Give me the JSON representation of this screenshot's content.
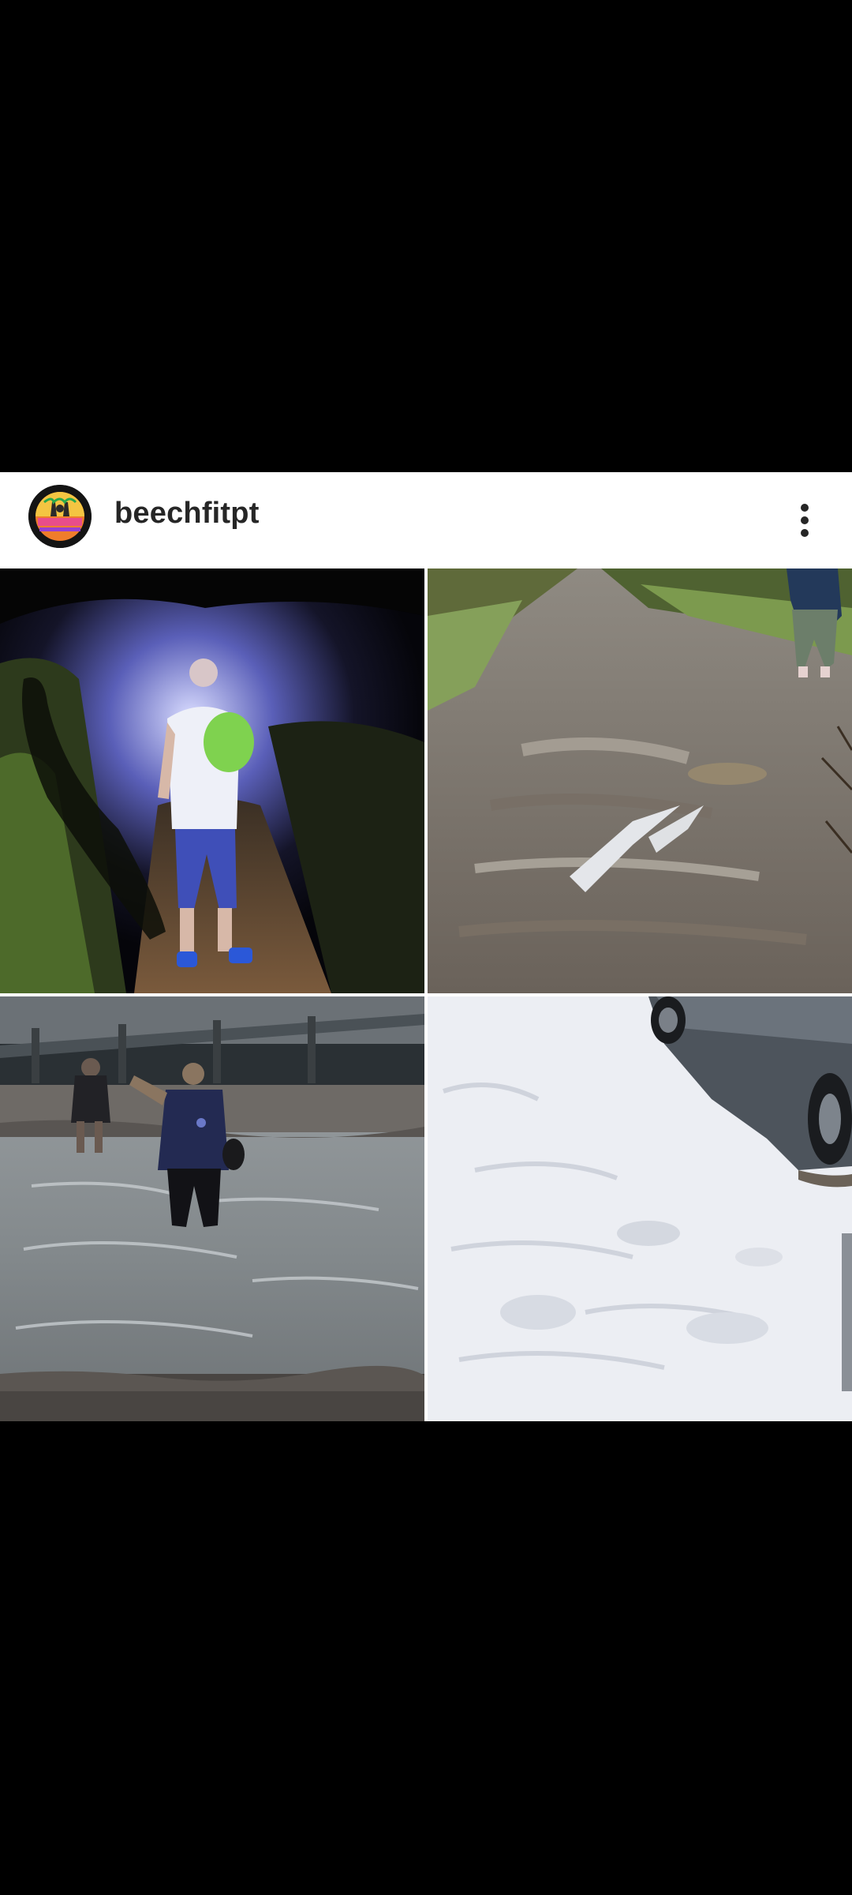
{
  "post": {
    "username": "beechfitpt",
    "avatar_icon": "beech-fit-logo-icon",
    "more_icon": "more-vertical-icon"
  },
  "collage": {
    "tiles": [
      {
        "id": "night-walk-photo"
      },
      {
        "id": "muddy-trail-photo"
      },
      {
        "id": "river-crossing-photo"
      },
      {
        "id": "snow-ground-photo"
      }
    ]
  },
  "colors": {
    "header_background": "#ffffff",
    "username_text": "#262626",
    "screen_background": "#000000"
  }
}
